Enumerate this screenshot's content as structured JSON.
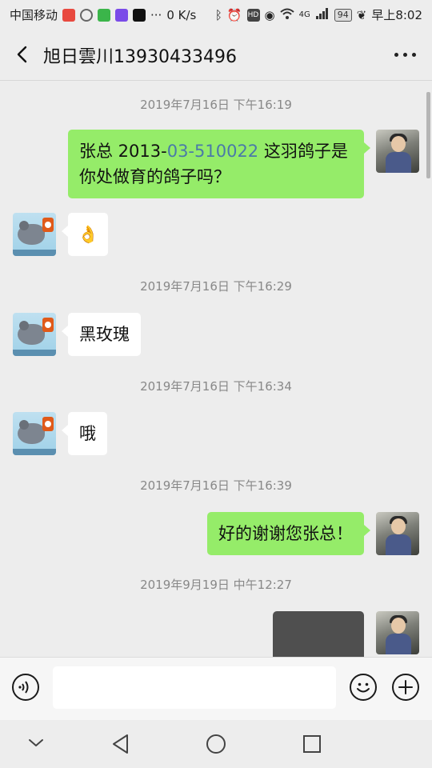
{
  "status_bar": {
    "carrier": "中国移动",
    "network_speed": "0 K/s",
    "signal_label": "4G",
    "battery_level": "94",
    "time": "早上8:02",
    "ellipsis": "···"
  },
  "header": {
    "title": "旭日雲川13930433496"
  },
  "messages": [
    {
      "type": "timestamp",
      "text": "2019年7月16日 下午16:19"
    },
    {
      "type": "sent",
      "parts": [
        "张总 2013-",
        "03-510022",
        " 这羽鸽子是你处做育的鸽子吗？"
      ]
    },
    {
      "type": "received",
      "emoji": "👌"
    },
    {
      "type": "timestamp",
      "text": "2019年7月16日 下午16:29"
    },
    {
      "type": "received",
      "text": "黑玫瑰"
    },
    {
      "type": "timestamp",
      "text": "2019年7月16日 下午16:34"
    },
    {
      "type": "received",
      "text": "哦"
    },
    {
      "type": "timestamp",
      "text": "2019年7月16日 下午16:39"
    },
    {
      "type": "sent",
      "text": "好的谢谢您张总！"
    },
    {
      "type": "timestamp",
      "text": "2019年9月19日 中午12:27"
    },
    {
      "type": "sent-media"
    }
  ],
  "input": {
    "value": "",
    "placeholder": ""
  },
  "colors": {
    "sent_bubble": "#95ec69",
    "received_bubble": "#ffffff",
    "background": "#ededed",
    "link": "#4a7aa8"
  },
  "icons": {
    "back": "chevron-left-icon",
    "more": "more-dots-icon",
    "voice": "voice-icon",
    "emoji": "emoji-icon",
    "plus": "plus-icon",
    "nav_down": "chevron-down-icon",
    "nav_back": "triangle-back-icon",
    "nav_home": "circle-home-icon",
    "nav_recent": "square-recent-icon"
  }
}
